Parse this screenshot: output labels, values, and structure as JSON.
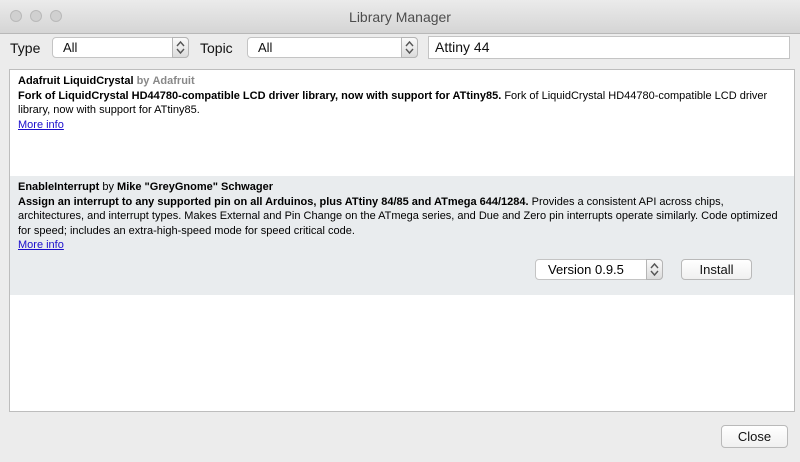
{
  "window": {
    "title": "Library Manager"
  },
  "filters": {
    "type_label": "Type",
    "type_value": "All",
    "topic_label": "Topic",
    "topic_value": "All",
    "search_value": "Attiny 44"
  },
  "libraries": [
    {
      "name": "Adafruit LiquidCrystal",
      "by": "by",
      "author": "Adafruit",
      "summary": "Fork of LiquidCrystal HD44780-compatible LCD driver library, now with support for ATtiny85.",
      "description": "Fork of LiquidCrystal HD44780-compatible LCD driver library, now with support for ATtiny85.",
      "more_info": "More info"
    },
    {
      "name": "EnableInterrupt",
      "by": "by",
      "author": "Mike \"GreyGnome\" Schwager",
      "summary": "Assign an interrupt to any supported pin on all Arduinos, plus ATtiny 84/85 and ATmega 644/1284.",
      "description": "Provides a consistent API across chips, architectures, and interrupt types. Makes External and Pin Change on the ATmega series, and Due and Zero pin interrupts operate similarly. Code optimized for speed; includes an extra-high-speed mode for speed critical code.",
      "more_info": "More info",
      "version": "Version 0.9.5",
      "install_label": "Install"
    }
  ],
  "footer": {
    "close_label": "Close"
  },
  "colors": {
    "accent": "#2d74e9",
    "link": "#1a0dcc",
    "selected_row": "#e9ecee"
  },
  "icons": {
    "stepper": "up-down-chevron-icon"
  }
}
